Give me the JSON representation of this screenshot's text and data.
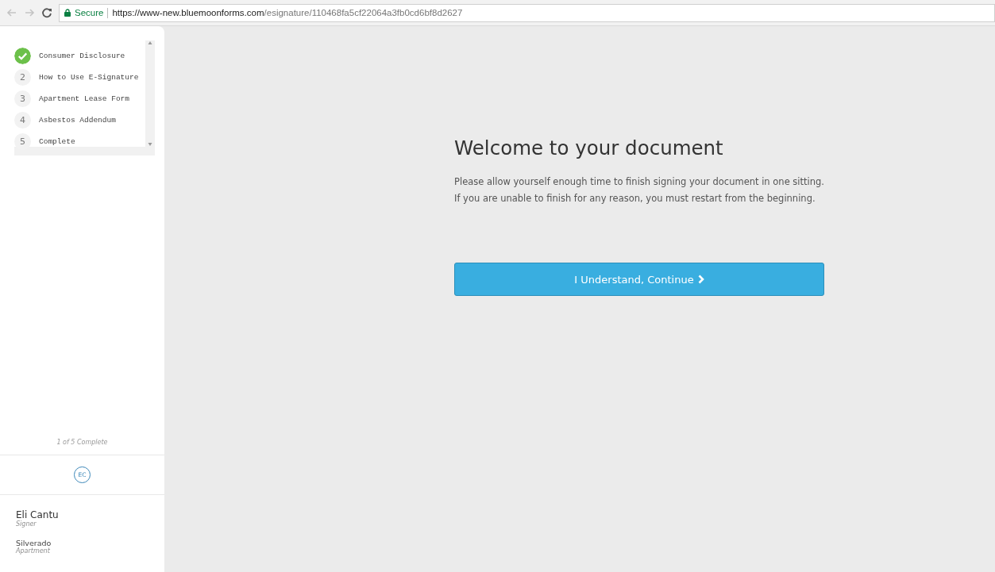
{
  "browser": {
    "secure_label": "Secure",
    "url_host": "https://www-new.bluemoonforms.com",
    "url_path": "/esignature/110468fa5cf22064a3fb0cd6bf8d2627"
  },
  "steps": [
    {
      "label": "Consumer Disclosure",
      "completed": true
    },
    {
      "number": "2",
      "label": "How to Use E-Signature",
      "completed": false
    },
    {
      "number": "3",
      "label": "Apartment Lease Form",
      "completed": false
    },
    {
      "number": "4",
      "label": "Asbestos Addendum",
      "completed": false
    },
    {
      "number": "5",
      "label": "Complete",
      "completed": false
    }
  ],
  "progress": "1 of 5 Complete",
  "signer": {
    "initials": "EC",
    "name": "Eli Cantu",
    "role": "Signer",
    "property": "Silverado",
    "property_type": "Apartment"
  },
  "main": {
    "title": "Welcome to your document",
    "body": "Please allow yourself enough time to finish signing your document in one sitting. If you are unable to finish for any reason, you must restart from the beginning.",
    "button": "I Understand, Continue"
  }
}
